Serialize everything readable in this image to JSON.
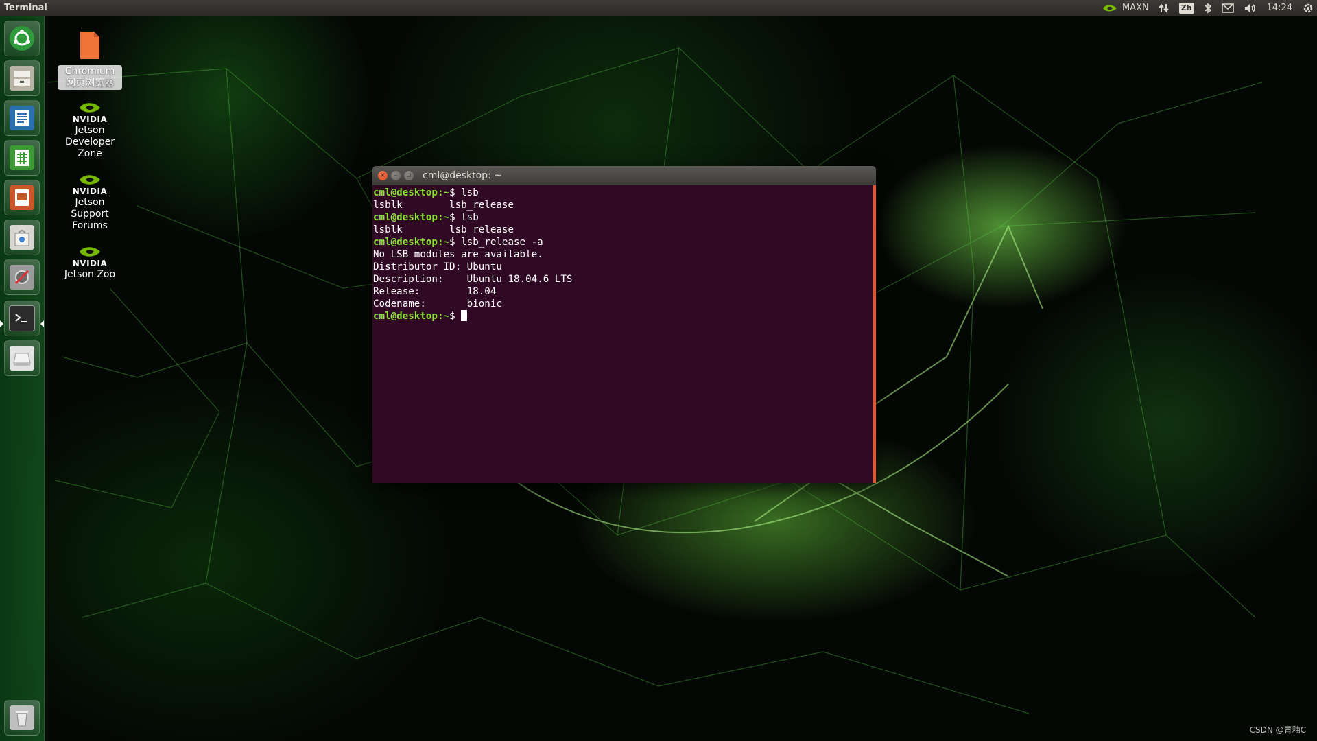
{
  "top_panel": {
    "app_title": "Terminal",
    "power_mode": "MAXN",
    "input_method": "Zh",
    "clock": "14:24"
  },
  "launcher": {
    "items": [
      {
        "name": "ubuntu-dash",
        "icon": "ubuntu-logo-icon",
        "color": "#2e9a3a"
      },
      {
        "name": "files",
        "icon": "file-cabinet-icon",
        "color": "#b8b2a5"
      },
      {
        "name": "libreoffice-writer",
        "icon": "writer-document-icon",
        "color": "#2a6fb0"
      },
      {
        "name": "libreoffice-calc",
        "icon": "calc-spreadsheet-icon",
        "color": "#3e9a35"
      },
      {
        "name": "libreoffice-impress",
        "icon": "impress-presentation-icon",
        "color": "#c8582a"
      },
      {
        "name": "software-center",
        "icon": "shopping-bag-icon",
        "color": "#d8d6d0"
      },
      {
        "name": "system-settings",
        "icon": "wrench-screwdriver-icon",
        "color": "#9b9b9b"
      },
      {
        "name": "terminal",
        "icon": "terminal-prompt-icon",
        "color": "#2b2b2b"
      },
      {
        "name": "removable-drive",
        "icon": "drive-icon",
        "color": "#e2e2e2"
      },
      {
        "name": "trash",
        "icon": "trash-icon",
        "color": "#bfbfbf"
      }
    ]
  },
  "desktop_icons": [
    {
      "label_lines": [
        "Chromium",
        "网页浏览器"
      ],
      "icon": "chromium-file-icon"
    },
    {
      "label_lines": [
        "Jetson",
        "Developer",
        "Zone"
      ],
      "icon": "nvidia-logo-icon"
    },
    {
      "label_lines": [
        "Jetson",
        "Support",
        "Forums"
      ],
      "icon": "nvidia-logo-icon"
    },
    {
      "label_lines": [
        "Jetson Zoo"
      ],
      "icon": "nvidia-logo-icon"
    }
  ],
  "nvidia_brand": "NVIDIA",
  "terminal": {
    "title": "cml@desktop: ~",
    "prompt": "cml@desktop:~$ ",
    "lines": [
      {
        "prompt": "cml@desktop:~$ ",
        "text": "lsb"
      },
      {
        "prompt": "",
        "text": "lsblk        lsb_release"
      },
      {
        "prompt": "cml@desktop:~$ ",
        "text": "lsb"
      },
      {
        "prompt": "",
        "text": "lsblk        lsb_release"
      },
      {
        "prompt": "cml@desktop:~$ ",
        "text": "lsb_release -a"
      },
      {
        "prompt": "",
        "text": "No LSB modules are available."
      },
      {
        "prompt": "",
        "text": "Distributor ID:\tUbuntu"
      },
      {
        "prompt": "",
        "text": "Description:\tUbuntu 18.04.6 LTS"
      },
      {
        "prompt": "",
        "text": "Release:\t18.04"
      },
      {
        "prompt": "",
        "text": "Codename:\tbionic"
      }
    ],
    "colors": {
      "background": "#300a24",
      "prompt": "#8ae234",
      "text": "#ffffff",
      "scrollbar": "#e95420"
    }
  },
  "watermark": "CSDN @青釉C"
}
